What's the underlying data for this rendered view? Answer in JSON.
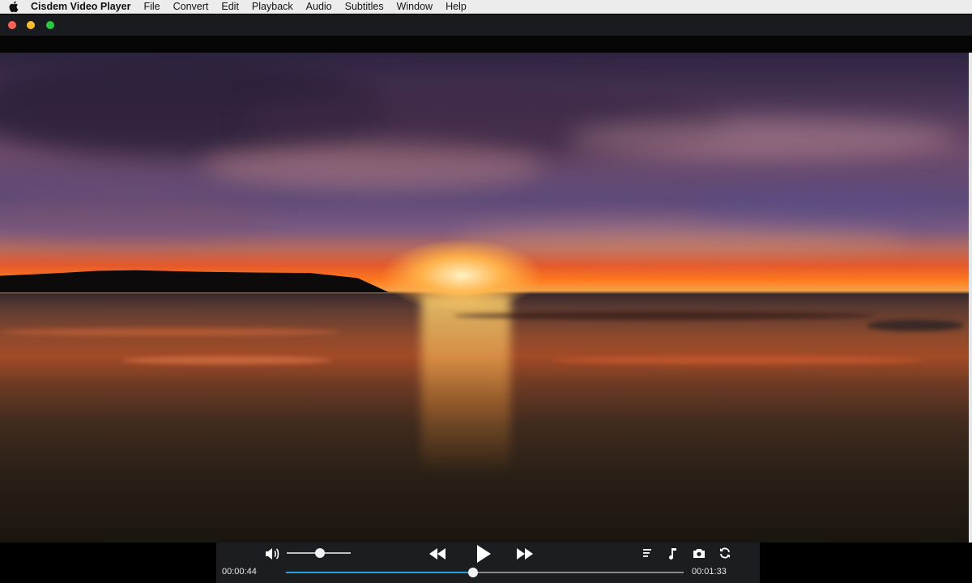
{
  "menubar": {
    "app_name": "Cisdem Video Player",
    "items": [
      "File",
      "Convert",
      "Edit",
      "Playback",
      "Audio",
      "Subtitles",
      "Window",
      "Help"
    ]
  },
  "player": {
    "current_time": "00:00:44",
    "duration": "00:01:33",
    "progress_fraction": 0.47,
    "volume_fraction": 0.5
  },
  "icons": [
    "apple-icon",
    "volume-icon",
    "rewind-icon",
    "play-icon",
    "fast-forward-icon",
    "playlist-icon",
    "music-note-icon",
    "camera-icon",
    "loop-icon"
  ],
  "colors": {
    "menubar_bg": "#ececec",
    "titlebar_bg": "#1a1b1e",
    "controls_bg": "#1c1d21",
    "seek_accent": "#2a9fe0",
    "traffic_red": "#fe5f57",
    "traffic_yellow": "#febc2e",
    "traffic_green": "#28c840"
  }
}
